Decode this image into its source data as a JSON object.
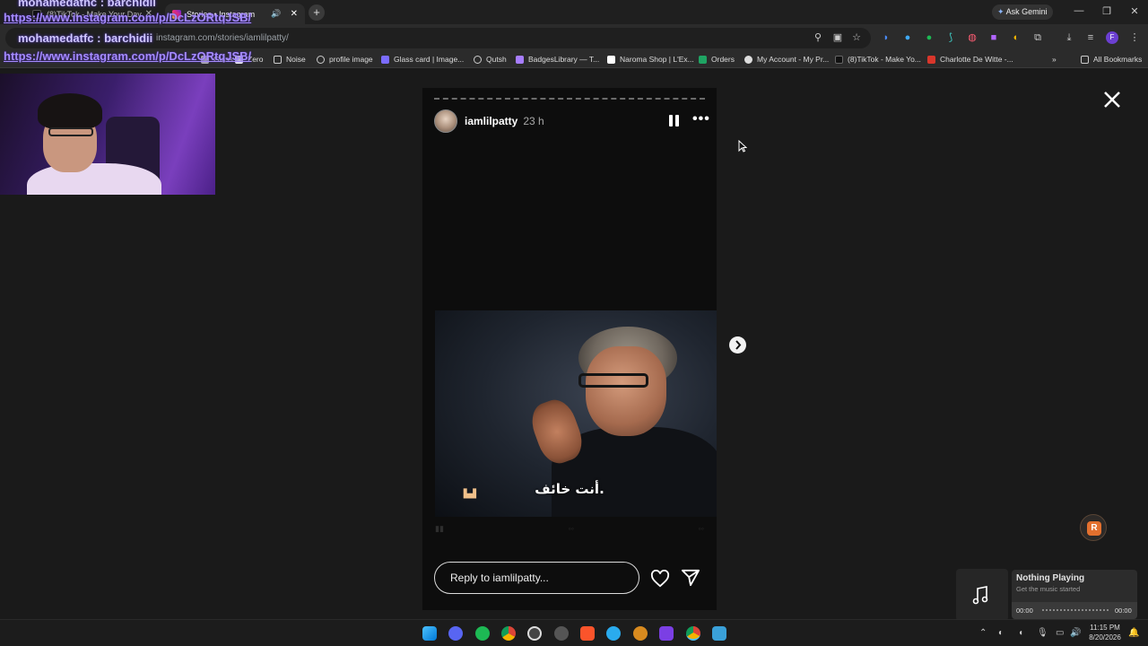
{
  "browser": {
    "tabs": [
      {
        "label": "(8)TikTok - Make Your Day",
        "active": false
      },
      {
        "label": "Stories • Instagram",
        "active": true
      }
    ],
    "new_tab_icon": "plus-icon",
    "ask_gemini": "Ask Gemini",
    "url": "instagram.com/stories/iamlilpatty/",
    "bookmarks": [
      "Glass",
      "Zero",
      "Noise",
      "profile image",
      "Glass card | Image...",
      "Qutsh",
      "BadgesLibrary — T...",
      "Naroma Shop | L'Ex...",
      "Orders",
      "My Account - My Pr...",
      "(8)TikTok - Make Yo...",
      "Charlotte De Witte -..."
    ],
    "all_bookmarks": "All Bookmarks"
  },
  "overlay": {
    "name1": "mohamedathc : barchidii",
    "url1": "https://www.instagram.com/p/DcLzORtqJSB/",
    "name2": "mohamedatfc : barchidii",
    "url2": "https://www.instagram.com/p/DcLzORtqJSB/"
  },
  "story": {
    "username": "iamlilpatty",
    "time_ago": "23 h",
    "subtitle": "أنت خائف.",
    "reply_placeholder": "Reply to iamlilpatty...",
    "icons": {
      "pause": "pause-icon",
      "more": "more-icon",
      "like": "heart-icon",
      "share": "send-icon",
      "next": "chevron-right-icon",
      "close": "close-icon"
    }
  },
  "music": {
    "title": "Nothing Playing",
    "subtitle": "Get the music started",
    "start": "00:00",
    "end": "00:00"
  },
  "taskbar": {
    "time": "11:15 PM",
    "date": "8/20/2026"
  },
  "colors": {
    "accent": "#a58bff",
    "background": "#1a1a1a",
    "story_bg": "#0d0d0d"
  }
}
